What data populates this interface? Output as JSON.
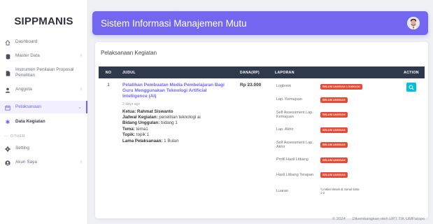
{
  "brand": "SIPPMANIS",
  "sidebar": {
    "items": [
      {
        "label": "Dashboard",
        "icon": "home-icon"
      },
      {
        "label": "Master Data",
        "icon": "database-icon"
      },
      {
        "label": "Instrumen Penilaian Proposal Penelitian",
        "icon": "document-icon"
      },
      {
        "label": "Anggota",
        "icon": "user-icon"
      },
      {
        "label": "Pelaksanaan",
        "icon": "calendar-icon"
      },
      {
        "label": "Data Kegiatan",
        "icon": "asterisk-icon"
      },
      {
        "label": "Setting",
        "icon": "gear-icon"
      },
      {
        "label": "Akun Saya",
        "icon": "account-icon"
      }
    ],
    "section_label": "OTHER"
  },
  "header": {
    "title": "Sistem Informasi Manajemen Mutu"
  },
  "card": {
    "title": "Pelaksanaan Kegiatan"
  },
  "table": {
    "headers": [
      "NO",
      "JUDUL",
      "DANA(RP)",
      "LAPORAN",
      "ACTION"
    ],
    "row": {
      "no": "1",
      "judul": "Pelatihan Pembuatan Media Pembelajaran Bagi Guru Menggunakan Teknologi Artificial Intelligence (AI)",
      "ago": "2 days ago",
      "ketua_label": "Ketua:",
      "ketua": "Rahmat Siswanto",
      "jadwal_label": "Jadwal Kegiatan:",
      "jadwal": "penelitian teknologi ai",
      "bidang_label": "Bidang Unggulan:",
      "bidang": "bidang 1",
      "tema_label": "Tema:",
      "tema": "tema1",
      "topik_label": "Topik:",
      "topik": "topik 1",
      "lama_label": "Lama Pelaksanaan:",
      "lama": "1 Bulan",
      "dana": "Rp 23.000",
      "laporan": [
        {
          "label": "Logbook",
          "badge": "BELUM UNGGAH LOGBOOK"
        },
        {
          "label": "Lap. Kemajuan",
          "badge": "BELUM UNGGAH"
        },
        {
          "label": "Self Assessment Lap. Kemajuan",
          "badge": "BELUM UNGGAH"
        },
        {
          "label": "Lap. Akhir",
          "badge": "BELUM UNGGAH"
        },
        {
          "label": "Self Assessment Lap. Akhir",
          "badge": "BELUM UNGGAH"
        },
        {
          "label": "Profil Hasil Litbang",
          "badge": "BELUM UNGGAH"
        },
        {
          "label": "Hasil Litbang Terapan",
          "badge": "BELUM UNGGAH"
        },
        {
          "label": "Luaran",
          "note": "*) Artikel Ilmiah di Jurnal Sinta 1-2"
        }
      ]
    }
  },
  "footer": {
    "year": "© 2024",
    "credit": "Dikembangkan oleh UPT TIK UMPalopo"
  },
  "colors": {
    "accent": "#7367f0",
    "badge": "#ea4a33",
    "action": "#00c2e0",
    "table_header": "#2e3a4b"
  }
}
